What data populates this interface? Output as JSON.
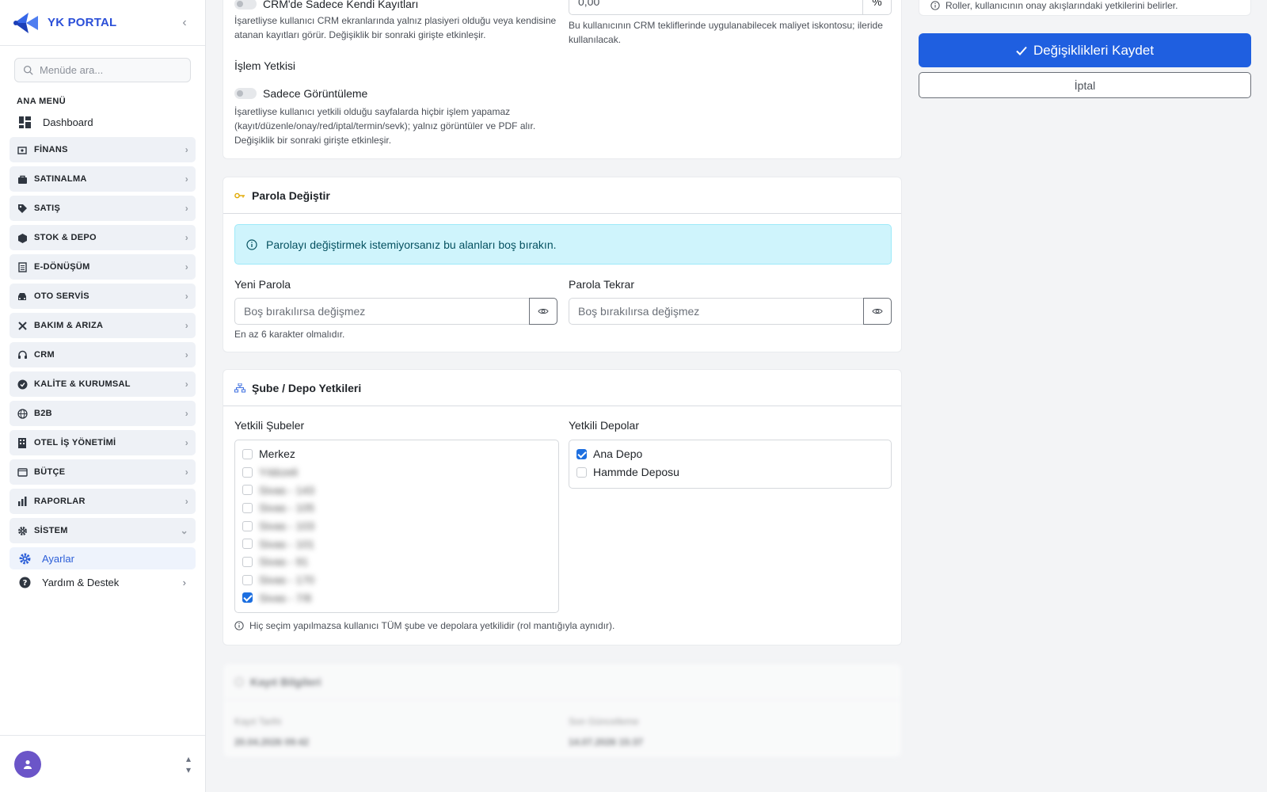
{
  "sidebar": {
    "brand": "YK PORTAL",
    "search_placeholder": "Menüde ara...",
    "section_label": "ANA MENÜ",
    "dashboard": "Dashboard",
    "groups": [
      "FİNANS",
      "SATINALMA",
      "SATIŞ",
      "STOK & DEPO",
      "E-DÖNÜŞÜM",
      "OTO SERVİS",
      "BAKIM & ARIZA",
      "CRM",
      "KALİTE & KURUMSAL",
      "B2B",
      "OTEL İŞ YÖNETİMİ",
      "BÜTÇE",
      "RAPORLAR",
      "SİSTEM"
    ],
    "active_sub": "Ayarlar",
    "help": "Yardım & Destek"
  },
  "perm_card": {
    "crm_toggle_label": "CRM'de Sadece Kendi Kayıtları",
    "crm_help": "İşaretliyse kullanıcı CRM ekranlarında yalnız plasiyeri olduğu veya kendisine atanan kayıtları görür. Değişiklik bir sonraki girişte etkinleşir.",
    "discount_value": "0,00",
    "discount_unit": "%",
    "discount_help": "Bu kullanıcının CRM tekliflerinde uygulanabilecek maliyet iskontosu; ileride kullanılacak.",
    "islem_title": "İşlem Yetkisi",
    "view_only_label": "Sadece Görüntüleme",
    "view_only_help": "İşaretliyse kullanıcı yetkili olduğu sayfalarda hiçbir işlem yapamaz (kayıt/düzenle/onay/red/iptal/termin/sevk); yalnız görüntüler ve PDF alır. Değişiklik bir sonraki girişte etkinleşir."
  },
  "password_card": {
    "title": "Parola Değiştir",
    "alert": "Parolayı değiştirmek istemiyorsanız bu alanları boş bırakın.",
    "new_label": "Yeni Parola",
    "new_placeholder": "Boş bırakılırsa değişmez",
    "new_help": "En az 6 karakter olmalıdır.",
    "repeat_label": "Parola Tekrar",
    "repeat_placeholder": "Boş bırakılırsa değişmez"
  },
  "branch_card": {
    "title": "Şube / Depo Yetkileri",
    "branches_label": "Yetkili Şubeler",
    "branches": [
      {
        "name": "Merkez",
        "checked": false,
        "blurred": false
      },
      {
        "name": "Yıldızeli",
        "checked": false,
        "blurred": true
      },
      {
        "name": "Sivas - 143",
        "checked": false,
        "blurred": true
      },
      {
        "name": "Sivas - 105",
        "checked": false,
        "blurred": true
      },
      {
        "name": "Sivas - 103",
        "checked": false,
        "blurred": true
      },
      {
        "name": "Sivas - 101",
        "checked": false,
        "blurred": true
      },
      {
        "name": "Sivas - 91",
        "checked": false,
        "blurred": true
      },
      {
        "name": "Sivas - 170",
        "checked": false,
        "blurred": true
      },
      {
        "name": "Sivas - 7/8",
        "checked": true,
        "blurred": true
      }
    ],
    "depots_label": "Yetkili Depolar",
    "depots": [
      {
        "name": "Ana Depo",
        "checked": true
      },
      {
        "name": "Hammde Deposu",
        "checked": false
      }
    ],
    "note": "Hiç seçim yapılmazsa kullanıcı TÜM şube ve depolara yetkilidir (rol mantığıyla aynıdır)."
  },
  "record_card": {
    "title": "Kayıt Bilgileri",
    "created_label": "Kayıt Tarihi",
    "created_value": "20.04.2026 09:42",
    "updated_label": "Son Güncelleme",
    "updated_value": "14.07.2026 15:37"
  },
  "right": {
    "roles_note": "Roller, kullanıcının onay akışlarındaki yetkilerini belirler.",
    "save_label": "Değişiklikleri Kaydet",
    "cancel_label": "İptal"
  },
  "colors": {
    "primary": "#1f5fe0",
    "brand": "#2b4fd8",
    "alert_bg": "#cff4fc",
    "alert_text": "#055160"
  }
}
